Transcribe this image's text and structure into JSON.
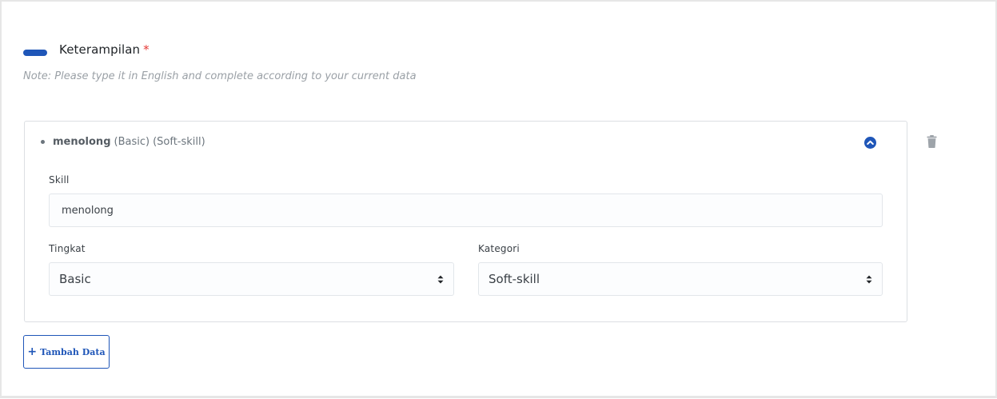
{
  "section": {
    "title": "Keterampilan",
    "required_mark": "*",
    "note": "Note: Please type it in English and complete according to your current data"
  },
  "skill_item": {
    "name": "menolong",
    "level_tag": "(Basic)",
    "category_tag": "(Soft-skill)",
    "skill_label": "Skill",
    "skill_value": "menolong",
    "level_label": "Tingkat",
    "level_value": "Basic",
    "category_label": "Kategori",
    "category_value": "Soft-skill"
  },
  "icons": {
    "collapse": "chevron-up-icon",
    "delete": "trash-icon",
    "add": "plus-icon",
    "select": "sort-arrows-icon"
  },
  "actions": {
    "add_label": "Tambah Data"
  },
  "colors": {
    "accent": "#1f56b8",
    "required": "#e53935",
    "muted": "#9aa0a6"
  }
}
